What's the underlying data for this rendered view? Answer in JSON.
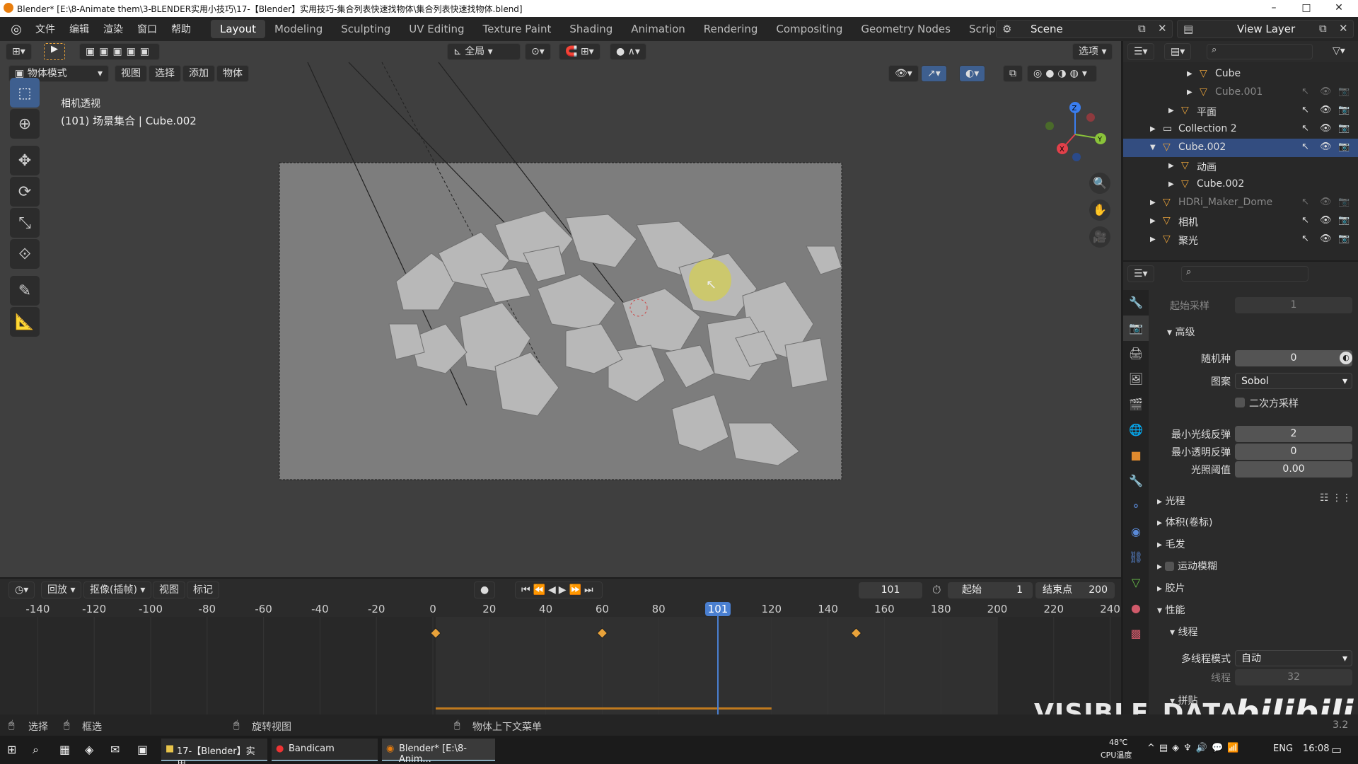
{
  "window": {
    "title": "Blender* [E:\\8-Animate them\\3-BLENDER实用小技巧\\17-【Blender】实用技巧-集合列表快速找物体\\集合列表快速找物体.blend]",
    "min": "–",
    "max": "□",
    "close": "✕"
  },
  "menu": [
    "文件",
    "编辑",
    "渲染",
    "窗口",
    "帮助"
  ],
  "workspaces": [
    "Layout",
    "Modeling",
    "Sculpting",
    "UV Editing",
    "Texture Paint",
    "Shading",
    "Animation",
    "Rendering",
    "Compositing",
    "Geometry Nodes",
    "Scripting"
  ],
  "active_workspace": "Layout",
  "scene": "Scene",
  "view_layer": "View Layer",
  "viewport_header": {
    "mode": "物体模式",
    "menus": [
      "视图",
      "选择",
      "添加",
      "物体"
    ],
    "transform_space": "全局",
    "options": "选项"
  },
  "viewport": {
    "view_name": "相机透视",
    "info": "(101) 场景集合 | Cube.002"
  },
  "outliner": {
    "items": [
      {
        "name": "Cube",
        "indent": 3,
        "expanded": false
      },
      {
        "name": "Cube.001",
        "indent": 3,
        "expanded": false,
        "dim": true
      },
      {
        "name": "平面",
        "indent": 2,
        "expanded": false
      },
      {
        "name": "Collection 2",
        "indent": 1,
        "expanded": false
      },
      {
        "name": "Cube.002",
        "indent": 1,
        "expanded": true
      },
      {
        "name": "动画",
        "indent": 2,
        "expanded": false
      },
      {
        "name": "Cube.002",
        "indent": 2,
        "expanded": false
      },
      {
        "name": "HDRi_Maker_Dome",
        "indent": 1,
        "expanded": false,
        "dim": true
      },
      {
        "name": "相机",
        "indent": 1,
        "expanded": false
      },
      {
        "name": "聚光",
        "indent": 1,
        "expanded": false
      }
    ]
  },
  "properties": {
    "start_sample_label": "起始采样",
    "start_sample_value": "1",
    "advanced_label": "高级",
    "seed_label": "随机种",
    "seed_value": "0",
    "pattern_label": "图案",
    "pattern_value": "Sobol",
    "scramble_label": "二次方采样",
    "min_bounces_label": "最小光线反弹",
    "min_bounces_value": "2",
    "min_transparent_label": "最小透明反弹",
    "min_transparent_value": "0",
    "light_threshold_label": "光照阈值",
    "light_threshold_value": "0.00",
    "panels": [
      "光程",
      "体积(卷标)",
      "毛发",
      "运动模糊",
      "胶片",
      "性能"
    ],
    "threads_label": "线程",
    "threads_mode_label": "多线程模式",
    "threads_mode_value": "自动",
    "threads_count_label": "线程",
    "threads_count_value": "32",
    "tiles_label": "拼贴"
  },
  "timeline": {
    "menus": [
      "回放",
      "抠像(插帧)",
      "视图",
      "标记"
    ],
    "current_frame": "101",
    "start_label": "起始",
    "start_value": "1",
    "end_label": "结束点",
    "end_value": "200",
    "ruler": [
      "-140",
      "-120",
      "-100",
      "-80",
      "-60",
      "-40",
      "-20",
      "0",
      "20",
      "40",
      "60",
      "80",
      "101",
      "120",
      "140",
      "160",
      "180",
      "200",
      "220",
      "240"
    ],
    "ruler_values": [
      -140,
      -120,
      -100,
      -80,
      -60,
      -40,
      -20,
      0,
      20,
      40,
      60,
      80,
      101,
      120,
      140,
      160,
      180,
      200,
      220,
      240
    ],
    "keyframes": [
      1,
      60,
      150
    ],
    "playhead": 101
  },
  "statusbar": {
    "select": "选择",
    "box_select": "框选",
    "rotate_view": "旋转视图",
    "context_menu": "物体上下文菜单",
    "version": "3.2"
  },
  "watermark": "VISIBLE_DATA",
  "bili": "bilibili",
  "taskbar": {
    "apps": [
      "17-【Blender】实用...",
      "Bandicam",
      "Blender* [E:\\8-Anim..."
    ],
    "temp": "48℃",
    "temp_label": "CPU温度",
    "lang": "ENG",
    "time": "16:08"
  }
}
